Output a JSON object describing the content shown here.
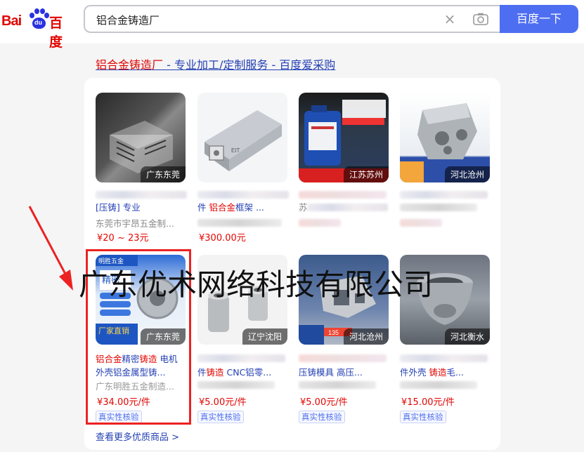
{
  "logo": {
    "latin": "Bai",
    "du": "du",
    "chinese": "百度"
  },
  "search": {
    "query": "铝合金铸造厂",
    "button_label": "百度一下"
  },
  "headline": {
    "highlight": "铝合金铸造厂",
    "rest": " - 专业加工/定制服务 - 百度爱采购"
  },
  "products": [
    {
      "location": "广东东莞",
      "title1": "[",
      "title1_hl": "",
      "title1_rest": "压铸] 专业",
      "title2": "东莞市宇昂五金制...",
      "price": "¥20 ~ 23元",
      "badge": ""
    },
    {
      "location": "",
      "title1": "件 ",
      "title1_hl": "铝合金",
      "title1_rest": "框架 ...",
      "title2": "",
      "price": "¥300.00元",
      "badge": ""
    },
    {
      "location": "江苏苏州",
      "title1": "苏",
      "title1_hl": "",
      "title1_rest": "",
      "title2": "",
      "price": "",
      "badge": ""
    },
    {
      "location": "河北沧州",
      "title1": "",
      "title1_hl": "",
      "title1_rest": "",
      "title2": "",
      "price": "",
      "badge": ""
    },
    {
      "location": "广东东莞",
      "title1": "",
      "title1_hl": "铝合金",
      "title1_rest": "精密",
      "title1_hl2": "铸造",
      "title1_rest2": " 电机",
      "title2": "外壳铝金属型铸...",
      "title3": "广东明胜五金制造...",
      "price": "¥34.00元/件",
      "badge": "真实性核验"
    },
    {
      "location": "辽宁沈阳",
      "title1": "",
      "title1_hl": "",
      "title1_rest": "",
      "title2_a": "件",
      "title2_hl": "铸造",
      "title2_b": " CNC铝零...",
      "price": "¥5.00元/件",
      "badge": "真实性核验"
    },
    {
      "location": "河北沧州",
      "title1": "",
      "title1_hl": "",
      "title1_rest": "",
      "title2": "压铸模具 高压...",
      "price": "¥5.00元/件",
      "badge": "真实性核验"
    },
    {
      "location": "河北衡水",
      "title1": "",
      "title1_hl": "",
      "title1_rest": "",
      "title2_a": "件外壳 ",
      "title2_hl": "铸造",
      "title2_b": "毛...",
      "price": "¥15.00元/件",
      "badge": "真实性核验"
    }
  ],
  "overlay_text": {
    "thumb5_top": "明胜五金",
    "thumb5_mid": "精密",
    "thumb5_bottom": "厂家直销",
    "thumb3_top": "钝化液",
    "thumb3_bottom": "免费试样 急速",
    "thumb4_bottom": "远达模具 诚信经营",
    "thumb7_bottom": "启隆机械",
    "thumb7_num": "135"
  },
  "more_link": "查看更多优质商品 >",
  "watermark": "广东优术网络科技有限公司",
  "colors": {
    "link": "#2440b3",
    "highlight": "#e10602",
    "button": "#4e6ef2",
    "annotation": "#ec2222"
  }
}
